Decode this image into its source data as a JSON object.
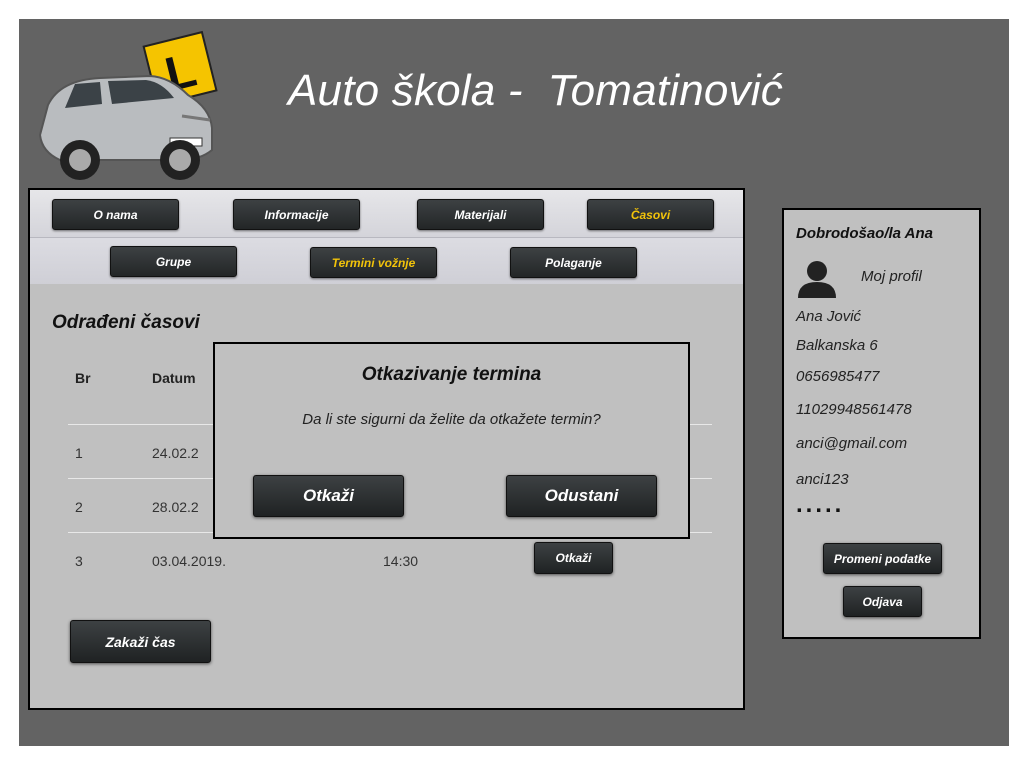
{
  "header": {
    "title": "Auto škola -  Tomatinović"
  },
  "nav": {
    "top": [
      "O nama",
      "Informacije",
      "Materijali",
      "Časovi"
    ],
    "sub": [
      "Grupe",
      "Termini vožnje",
      "Polaganje"
    ]
  },
  "main": {
    "section_title": "Odrađeni časovi",
    "columns": [
      "Br",
      "Datum"
    ],
    "rows": [
      {
        "br": "1",
        "datum": "24.02.2"
      },
      {
        "br": "2",
        "datum": "28.02.2"
      },
      {
        "br": "3",
        "datum": "03.04.2019.",
        "vreme": "14:30",
        "action": "Otkaži"
      }
    ],
    "schedule_button": "Zakaži čas"
  },
  "modal": {
    "title": "Otkazivanje termina",
    "message": "Da li ste sigurni da želite da otkažete termin?",
    "confirm": "Otkaži",
    "cancel": "Odustani"
  },
  "sidebar": {
    "welcome": "Dobrodošao/la Ana",
    "profile_link": "Moj profil",
    "name": "Ana Jović",
    "address": "Balkanska 6",
    "phone": "0656985477",
    "jmbg": "11029948561478",
    "email": "anci@gmail.com",
    "username": "anci123",
    "password_mask": ".....",
    "edit_button": "Promeni podatke",
    "logout_button": "Odjava"
  },
  "colors": {
    "frame": "#636363",
    "panel": "#c0c0c0",
    "active_nav": "#f2c30a",
    "button": "#2b2e2f"
  }
}
